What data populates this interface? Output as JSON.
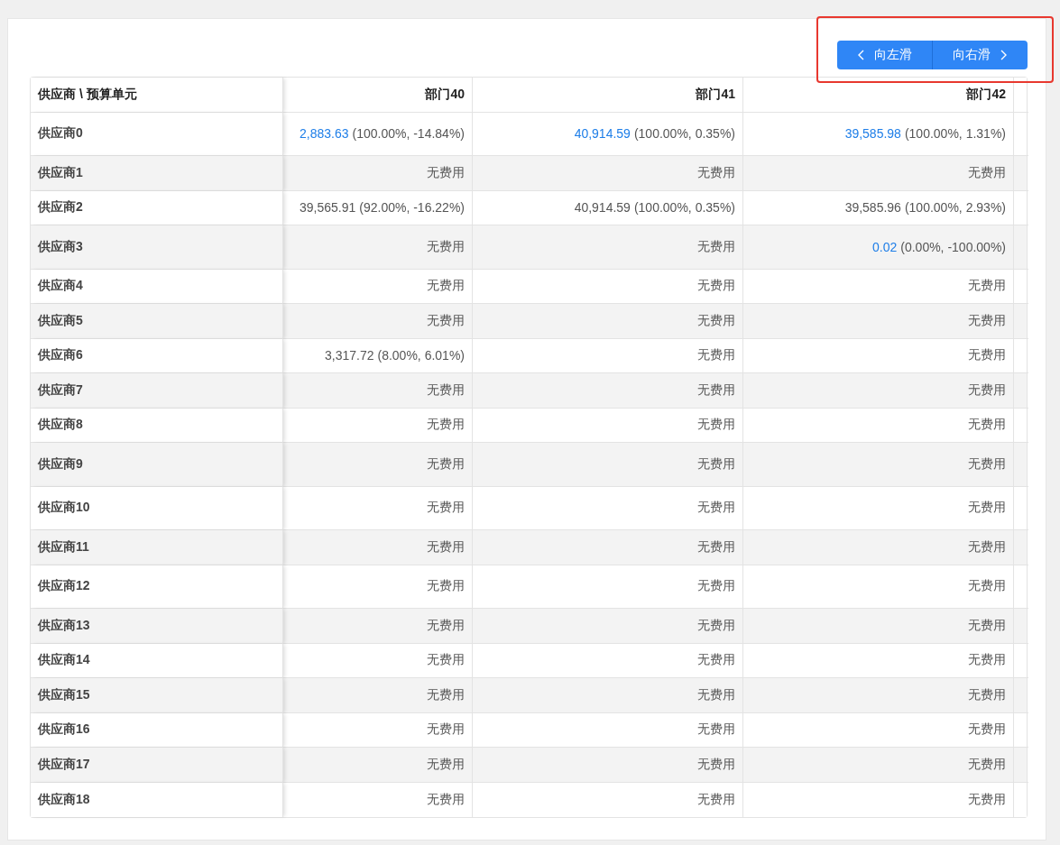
{
  "slide_buttons": [
    {
      "kind": "left",
      "label": "向左滑"
    },
    {
      "kind": "right",
      "label": "向右滑"
    }
  ],
  "table": {
    "corner": "供应商 \\ 预算单元",
    "columns": [
      "部门40",
      "部门41",
      "部门42"
    ],
    "rows": [
      {
        "name": "供应商0",
        "cells": [
          {
            "kind": "amount",
            "amount": "2,883.63",
            "detail": "(100.00%, -14.84%)",
            "link": true
          },
          {
            "kind": "amount",
            "amount": "40,914.59",
            "detail": "(100.00%, 0.35%)",
            "link": true
          },
          {
            "kind": "amount",
            "amount": "39,585.98",
            "detail": "(100.00%, 1.31%)",
            "link": true
          }
        ]
      },
      {
        "name": "供应商1",
        "cells": [
          {
            "kind": "none",
            "text": "无费用"
          },
          {
            "kind": "none",
            "text": "无费用"
          },
          {
            "kind": "none",
            "text": "无费用"
          }
        ]
      },
      {
        "name": "供应商2",
        "cells": [
          {
            "kind": "amount",
            "amount": "39,565.91",
            "detail": "(92.00%, -16.22%)",
            "link": false
          },
          {
            "kind": "amount",
            "amount": "40,914.59",
            "detail": "(100.00%, 0.35%)",
            "link": false
          },
          {
            "kind": "amount",
            "amount": "39,585.96",
            "detail": "(100.00%, 2.93%)",
            "link": false
          }
        ]
      },
      {
        "name": "供应商3",
        "cells": [
          {
            "kind": "none",
            "text": "无费用"
          },
          {
            "kind": "none",
            "text": "无费用"
          },
          {
            "kind": "amount",
            "amount": "0.02",
            "detail": "(0.00%, -100.00%)",
            "link": true
          }
        ]
      },
      {
        "name": "供应商4",
        "cells": [
          {
            "kind": "none",
            "text": "无费用"
          },
          {
            "kind": "none",
            "text": "无费用"
          },
          {
            "kind": "none",
            "text": "无费用"
          }
        ]
      },
      {
        "name": "供应商5",
        "cells": [
          {
            "kind": "none",
            "text": "无费用"
          },
          {
            "kind": "none",
            "text": "无费用"
          },
          {
            "kind": "none",
            "text": "无费用"
          }
        ]
      },
      {
        "name": "供应商6",
        "cells": [
          {
            "kind": "amount",
            "amount": "3,317.72",
            "detail": "(8.00%, 6.01%)",
            "link": false
          },
          {
            "kind": "none",
            "text": "无费用"
          },
          {
            "kind": "none",
            "text": "无费用"
          }
        ]
      },
      {
        "name": "供应商7",
        "cells": [
          {
            "kind": "none",
            "text": "无费用"
          },
          {
            "kind": "none",
            "text": "无费用"
          },
          {
            "kind": "none",
            "text": "无费用"
          }
        ]
      },
      {
        "name": "供应商8",
        "cells": [
          {
            "kind": "none",
            "text": "无费用"
          },
          {
            "kind": "none",
            "text": "无费用"
          },
          {
            "kind": "none",
            "text": "无费用"
          }
        ]
      },
      {
        "name": "供应商9",
        "cells": [
          {
            "kind": "none",
            "text": "无费用"
          },
          {
            "kind": "none",
            "text": "无费用"
          },
          {
            "kind": "none",
            "text": "无费用"
          }
        ]
      },
      {
        "name": "供应商10",
        "cells": [
          {
            "kind": "none",
            "text": "无费用"
          },
          {
            "kind": "none",
            "text": "无费用"
          },
          {
            "kind": "none",
            "text": "无费用"
          }
        ]
      },
      {
        "name": "供应商11",
        "cells": [
          {
            "kind": "none",
            "text": "无费用"
          },
          {
            "kind": "none",
            "text": "无费用"
          },
          {
            "kind": "none",
            "text": "无费用"
          }
        ]
      },
      {
        "name": "供应商12",
        "cells": [
          {
            "kind": "none",
            "text": "无费用"
          },
          {
            "kind": "none",
            "text": "无费用"
          },
          {
            "kind": "none",
            "text": "无费用"
          }
        ]
      },
      {
        "name": "供应商13",
        "cells": [
          {
            "kind": "none",
            "text": "无费用"
          },
          {
            "kind": "none",
            "text": "无费用"
          },
          {
            "kind": "none",
            "text": "无费用"
          }
        ]
      },
      {
        "name": "供应商14",
        "cells": [
          {
            "kind": "none",
            "text": "无费用"
          },
          {
            "kind": "none",
            "text": "无费用"
          },
          {
            "kind": "none",
            "text": "无费用"
          }
        ]
      },
      {
        "name": "供应商15",
        "cells": [
          {
            "kind": "none",
            "text": "无费用"
          },
          {
            "kind": "none",
            "text": "无费用"
          },
          {
            "kind": "none",
            "text": "无费用"
          }
        ]
      },
      {
        "name": "供应商16",
        "cells": [
          {
            "kind": "none",
            "text": "无费用"
          },
          {
            "kind": "none",
            "text": "无费用"
          },
          {
            "kind": "none",
            "text": "无费用"
          }
        ]
      },
      {
        "name": "供应商17",
        "cells": [
          {
            "kind": "none",
            "text": "无费用"
          },
          {
            "kind": "none",
            "text": "无费用"
          },
          {
            "kind": "none",
            "text": "无费用"
          }
        ]
      },
      {
        "name": "供应商18",
        "cells": [
          {
            "kind": "none",
            "text": "无费用"
          },
          {
            "kind": "none",
            "text": "无费用"
          },
          {
            "kind": "none",
            "text": "无费用"
          }
        ]
      }
    ]
  }
}
